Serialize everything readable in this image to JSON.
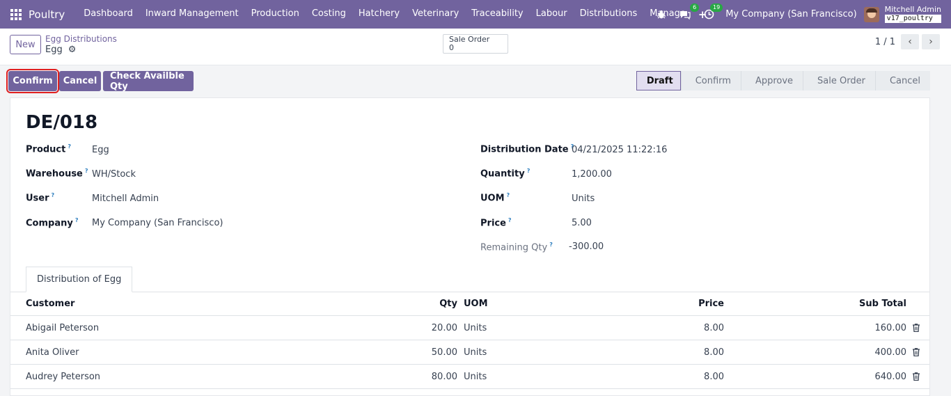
{
  "nav": {
    "brand": "Poultry",
    "menu": [
      "Dashboard",
      "Inward Management",
      "Production",
      "Costing",
      "Hatchery",
      "Veterinary",
      "Traceability",
      "Labour",
      "Distributions",
      "Manage"
    ],
    "plus": "+",
    "chat_count": "6",
    "activity_count": "19",
    "company": "My Company (San Francisco)",
    "user": "Mitchell Admin",
    "db": "v17_poultry"
  },
  "control": {
    "new_label": "New",
    "breadcrumb": "Egg Distributions",
    "record": "Egg",
    "smart_label": "Sale Order",
    "smart_value": "0",
    "pager": "1 / 1"
  },
  "actions": {
    "confirm": "Confirm",
    "cancel": "Cancel",
    "check": "Check Availble Qty"
  },
  "stages": [
    "Draft",
    "Confirm",
    "Approve",
    "Sale Order",
    "Cancel"
  ],
  "form": {
    "name": "DE/018",
    "product_label": "Product",
    "product": "Egg",
    "warehouse_label": "Warehouse",
    "warehouse": "WH/Stock",
    "user_label": "User",
    "user": "Mitchell Admin",
    "company_label": "Company",
    "company": "My Company (San Francisco)",
    "date_label": "Distribution Date",
    "date": "04/21/2025 11:22:16",
    "qty_label": "Quantity",
    "qty": "1,200.00",
    "uom_label": "UOM",
    "uom": "Units",
    "price_label": "Price",
    "price": "5.00",
    "remaining_label": "Remaining Qty",
    "remaining": "-300.00",
    "help": "?"
  },
  "tab": "Distribution of Egg",
  "table": {
    "headers": {
      "customer": "Customer",
      "qty": "Qty",
      "uom": "UOM",
      "price": "Price",
      "subtotal": "Sub Total"
    },
    "rows": [
      {
        "customer": "Abigail Peterson",
        "qty": "20.00",
        "uom": "Units",
        "price": "8.00",
        "subtotal": "160.00"
      },
      {
        "customer": "Anita Oliver",
        "qty": "50.00",
        "uom": "Units",
        "price": "8.00",
        "subtotal": "400.00"
      },
      {
        "customer": "Audrey Peterson",
        "qty": "80.00",
        "uom": "Units",
        "price": "8.00",
        "subtotal": "640.00"
      }
    ]
  }
}
